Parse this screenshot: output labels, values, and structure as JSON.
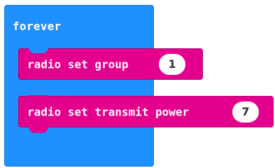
{
  "blocks": {
    "forever": {
      "label": "forever",
      "color": "#1e90ff"
    },
    "radio_set_group": {
      "label": "radio set group",
      "value": "1",
      "color": "#e3008c"
    },
    "radio_set_transmit_power": {
      "label": "radio set transmit power",
      "value": "7",
      "color": "#e3008c"
    }
  }
}
